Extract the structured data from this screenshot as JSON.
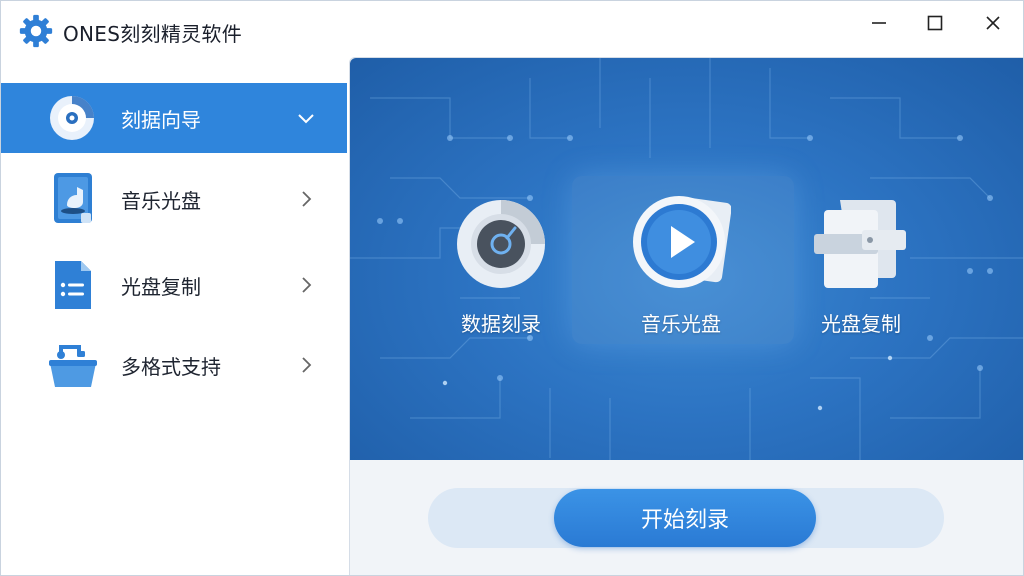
{
  "app": {
    "title": "ONES刻刻精灵软件",
    "icon": "gear-icon"
  },
  "window_controls": {
    "minimize": "minimize-icon",
    "maximize": "maximize-icon",
    "close": "close-icon"
  },
  "sidebar": {
    "items": [
      {
        "label": "刻据向导",
        "icon": "disc-icon",
        "active": true,
        "chevron": "chevron-down-icon"
      },
      {
        "label": "音乐光盘",
        "icon": "music-file-icon",
        "active": false,
        "chevron": "chevron-right-icon"
      },
      {
        "label": "光盘复制",
        "icon": "document-list-icon",
        "active": false,
        "chevron": "chevron-right-icon"
      },
      {
        "label": "多格式支持",
        "icon": "basket-icon",
        "active": false,
        "chevron": "chevron-right-icon"
      }
    ]
  },
  "main": {
    "features": [
      {
        "label": "数据刻录",
        "icon": "data-disc-icon"
      },
      {
        "label": "音乐光盘",
        "icon": "play-disc-icon"
      },
      {
        "label": "光盘复制",
        "icon": "copy-pages-icon"
      }
    ],
    "start_button": "开始刻录"
  },
  "colors": {
    "accent": "#2f85dc",
    "banner": "#2c73c2",
    "button": "#2a7ad4"
  }
}
